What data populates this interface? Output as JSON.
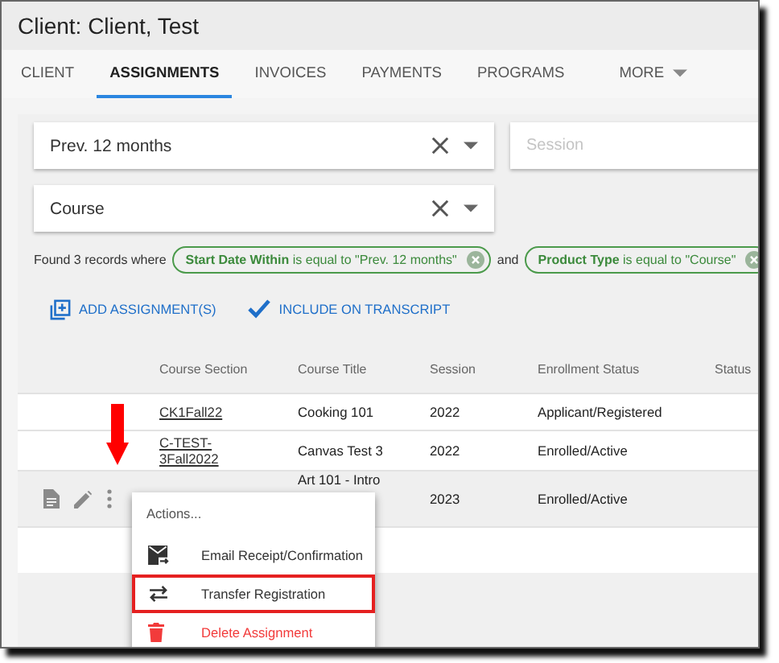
{
  "window": {
    "title": "Client: Client, Test"
  },
  "tabs": [
    {
      "label": "CLIENT",
      "selected": false
    },
    {
      "label": "ASSIGNMENTS",
      "selected": true
    },
    {
      "label": "INVOICES",
      "selected": false
    },
    {
      "label": "PAYMENTS",
      "selected": false
    },
    {
      "label": "PROGRAMS",
      "selected": false
    },
    {
      "label": "MORE",
      "selected": false,
      "kind": "dropdown"
    }
  ],
  "filters": [
    {
      "value": "Prev. 12 months"
    },
    {
      "placeholder": "Session"
    },
    {
      "value": "Course"
    }
  ],
  "filter_summary": {
    "prefix": "Found 3 records where",
    "chips": [
      "**Start Date Within** is equal to \"Prev. 12 months\"",
      "**Product Type** is equal to \"Course\""
    ],
    "connector": "and"
  },
  "toolbar": [
    {
      "label": "ADD ASSIGNMENT(S)",
      "kind": "add"
    },
    {
      "label": "INCLUDE ON TRANSCRIPT",
      "kind": "check"
    }
  ],
  "table": {
    "columns": [
      "Course Section",
      "Course Title",
      "Session",
      "Enrollment Status",
      "Status"
    ],
    "rows": [
      {
        "selected": false,
        "cells": [
          "CK1Fall22",
          "Cooking 101",
          "2022",
          "Applicant/Registered"
        ]
      },
      {
        "selected": false,
        "cells": [
          "C-TEST-3Fall2022",
          "Canvas Test 3",
          "2022",
          "Enrolled/Active"
        ]
      },
      {
        "selected": true,
        "cells": [
          "",
          "Art 101 - Intro",
          "2023",
          "Enrolled/Active"
        ]
      }
    ]
  },
  "context_menu": {
    "title": "Actions...",
    "items": [
      {
        "label": "Email Receipt/Confirmation",
        "kind": "email",
        "highlighted": false,
        "destructive": false
      },
      {
        "label": "Transfer Registration",
        "kind": "transfer",
        "highlighted": true,
        "destructive": false
      },
      {
        "label": "Delete Assignment",
        "kind": "delete",
        "highlighted": false,
        "destructive": true
      }
    ]
  }
}
